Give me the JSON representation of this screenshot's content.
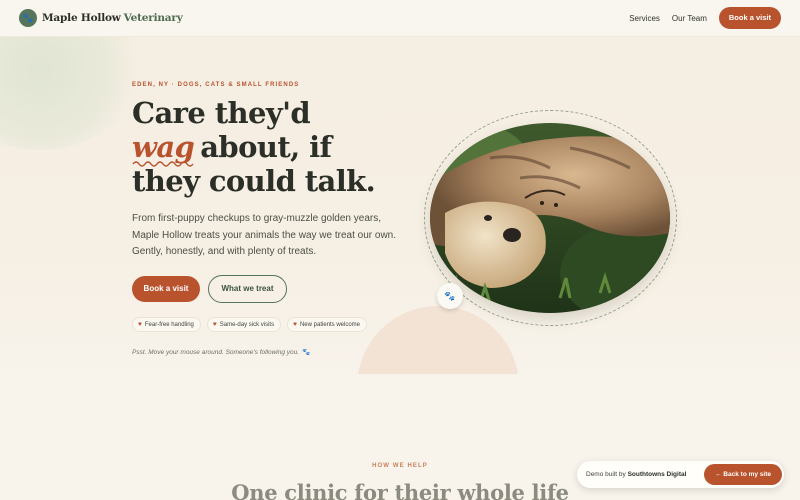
{
  "colors": {
    "accent": "#b9532e",
    "brand_green": "#56755a",
    "background": "#f8f4ec"
  },
  "header": {
    "logo_icon": "paw-icon",
    "brand_name": "Maple Hollow",
    "brand_suffix": "Veterinary",
    "nav": [
      "Services",
      "Our Team"
    ],
    "cta": "Book a visit"
  },
  "hero": {
    "eyebrow": "EDEN, NY · DOGS, CATS & SMALL FRIENDS",
    "headline_line1": "Care they'd",
    "headline_wag": "wag",
    "headline_line2_rest": "about, if",
    "headline_line3": "they could talk.",
    "lede": "From first-puppy checkups to gray-muzzle golden years, Maple Hollow treats your animals the way we treat our own. Gently, honestly, and with plenty of treats.",
    "primary_button": "Book a visit",
    "secondary_button": "What we treat",
    "chips": [
      "Fear-free handling",
      "Same-day sick visits",
      "New patients welcome"
    ],
    "chip_icon": "heart-icon",
    "psst": "Psst. Move your mouse around. Someone's following you.",
    "psst_icon": "paw-icon",
    "photo_badge_icon": "paw-icon"
  },
  "section": {
    "eyebrow": "HOW WE HELP",
    "title": "One clinic for their whole life"
  },
  "demo": {
    "text_prefix": "Demo built by",
    "builder": "Southtowns Digital",
    "button": "← Back to my site"
  }
}
